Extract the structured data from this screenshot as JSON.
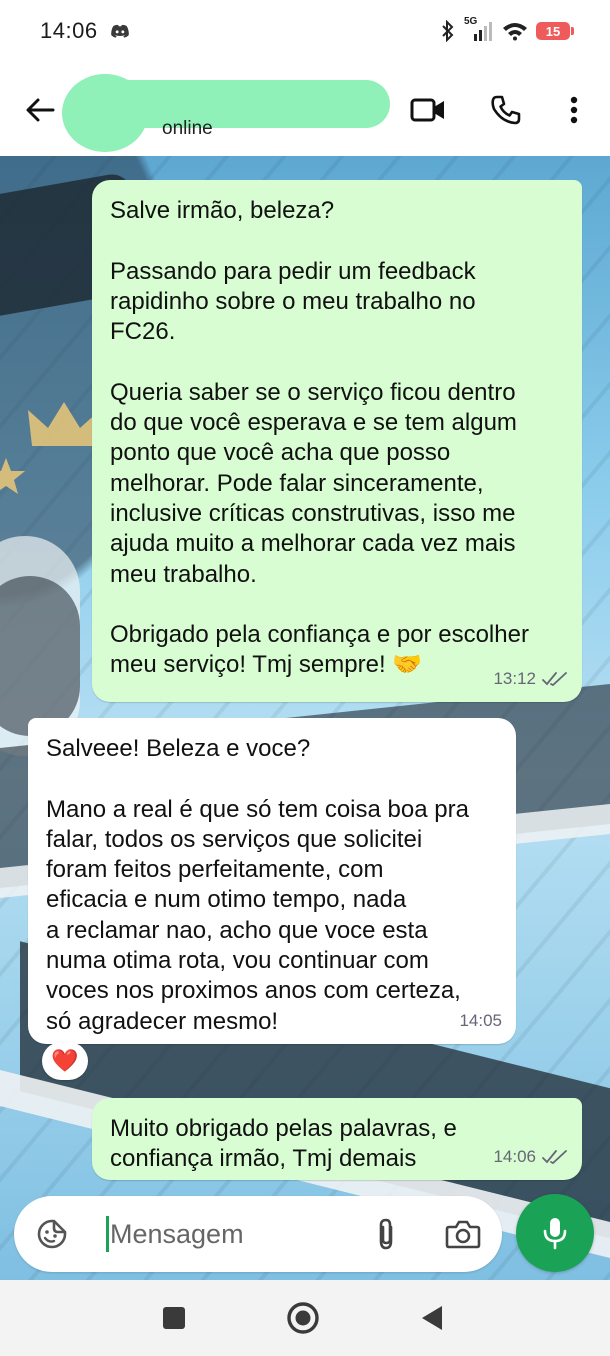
{
  "status_bar": {
    "time": "14:06",
    "network": "5G",
    "battery": "15",
    "icons": [
      "discord-icon",
      "bluetooth-icon",
      "signal-icon",
      "wifi-icon",
      "battery-icon"
    ]
  },
  "header": {
    "status": "online",
    "icons": [
      "back-arrow-icon",
      "video-call-icon",
      "phone-icon",
      "more-vert-icon"
    ]
  },
  "messages": [
    {
      "direction": "out",
      "text": "Salve irmão, beleza?\n\nPassando para pedir um feedback\nrapidinho sobre o meu trabalho no\nFC26.\n\nQueria saber se o serviço ficou dentro\ndo que você esperava e se tem algum\nponto que você acha que posso\nmelhorar. Pode falar sinceramente,\ninclusive críticas construtivas, isso me\najuda muito a melhorar cada vez mais\nmeu trabalho.\n\nObrigado pela confiança e por escolher\nmeu serviço! Tmj sempre! 🤝",
      "time": "13:12",
      "read": true
    },
    {
      "direction": "in",
      "text": "Salveee! Beleza e voce?\n\nMano a real é que só tem coisa boa pra\nfalar, todos os serviços que solicitei\nforam feitos perfeitamente, com\neficacia e num otimo tempo, nada\na reclamar nao, acho que voce esta\nnuma otima rota, vou continuar com\nvoces nos proximos anos com certeza,\nsó agradecer mesmo!",
      "time": "14:05",
      "reaction": "❤️"
    },
    {
      "direction": "out",
      "text": "Muito obrigado pelas palavras, e\nconfiança irmão, Tmj demais",
      "time": "14:06",
      "read": true
    }
  ],
  "composer": {
    "placeholder": "Mensagem",
    "icons": [
      "sticker-icon",
      "attach-icon",
      "camera-icon",
      "mic-icon"
    ]
  },
  "colors": {
    "outgoing_bubble": "#d8fdd2",
    "incoming_bubble": "#ffffff",
    "accent_green": "#1aa356",
    "battery_low": "#ef5a5a",
    "redaction": "#8ff0b8"
  },
  "nav_bar": {
    "icons": [
      "recents-square-icon",
      "home-circle-icon",
      "back-triangle-icon"
    ]
  }
}
